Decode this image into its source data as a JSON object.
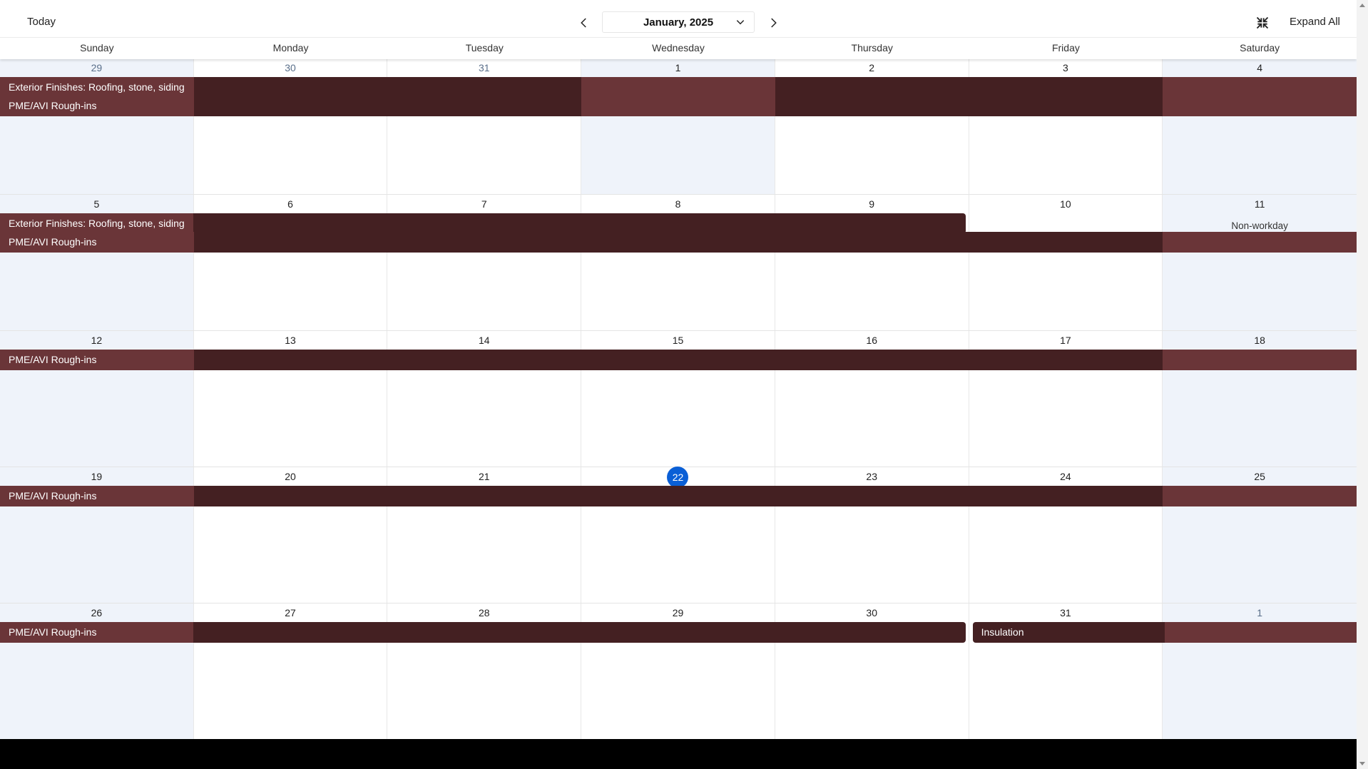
{
  "toolbar": {
    "today_label": "Today",
    "month_label": "January, 2025",
    "expand_label": "Expand All"
  },
  "weekdays": [
    "Sunday",
    "Monday",
    "Tuesday",
    "Wednesday",
    "Thursday",
    "Friday",
    "Saturday"
  ],
  "weeks": [
    {
      "days": [
        {
          "num": "29",
          "other_month": true
        },
        {
          "num": "30",
          "other_month": true
        },
        {
          "num": "31",
          "other_month": true
        },
        {
          "num": "1",
          "highlight": true
        },
        {
          "num": "2"
        },
        {
          "num": "3"
        },
        {
          "num": "4"
        }
      ],
      "events": [
        {
          "title": "Exterior Finishes: Roofing, stone, siding",
          "start": 0,
          "end": 6,
          "light": [
            0,
            3,
            6
          ],
          "sep": true
        },
        {
          "title": "PME/AVI Rough-ins",
          "start": 0,
          "end": 6,
          "light": [
            0,
            3,
            6
          ]
        }
      ]
    },
    {
      "days": [
        {
          "num": "5"
        },
        {
          "num": "6"
        },
        {
          "num": "7"
        },
        {
          "num": "8"
        },
        {
          "num": "9"
        },
        {
          "num": "10"
        },
        {
          "num": "11",
          "note": "Non-workday"
        }
      ],
      "events": [
        {
          "title": "Exterior Finishes: Roofing, stone, siding",
          "start": 0,
          "end": 4,
          "light": [
            0
          ],
          "sep": true,
          "round_end": true
        },
        {
          "title": "PME/AVI Rough-ins",
          "start": 0,
          "end": 6,
          "light": [
            0,
            6
          ]
        }
      ]
    },
    {
      "days": [
        {
          "num": "12"
        },
        {
          "num": "13"
        },
        {
          "num": "14"
        },
        {
          "num": "15"
        },
        {
          "num": "16"
        },
        {
          "num": "17"
        },
        {
          "num": "18"
        }
      ],
      "events": [
        {
          "title": "PME/AVI Rough-ins",
          "start": 0,
          "end": 6,
          "light": [
            0,
            6
          ]
        }
      ]
    },
    {
      "days": [
        {
          "num": "19"
        },
        {
          "num": "20"
        },
        {
          "num": "21"
        },
        {
          "num": "22",
          "today": true
        },
        {
          "num": "23"
        },
        {
          "num": "24"
        },
        {
          "num": "25"
        }
      ],
      "events": [
        {
          "title": "PME/AVI Rough-ins",
          "start": 0,
          "end": 6,
          "light": [
            0,
            6
          ]
        }
      ]
    },
    {
      "days": [
        {
          "num": "26"
        },
        {
          "num": "27"
        },
        {
          "num": "28"
        },
        {
          "num": "29"
        },
        {
          "num": "30"
        },
        {
          "num": "31"
        },
        {
          "num": "1",
          "other_month": true
        }
      ],
      "events": [
        {
          "title": "PME/AVI Rough-ins",
          "start": 0,
          "end": 4,
          "light": [
            0
          ],
          "round_end": true
        },
        {
          "title": "Insulation",
          "start": 5,
          "end": 6,
          "light": [
            6
          ],
          "same_row": true
        }
      ]
    }
  ],
  "colors": {
    "event_dark": "#442022",
    "event_light": "#6a3538",
    "weekend_bg": "#eff3fa",
    "today_circle": "#0a5fd6"
  }
}
